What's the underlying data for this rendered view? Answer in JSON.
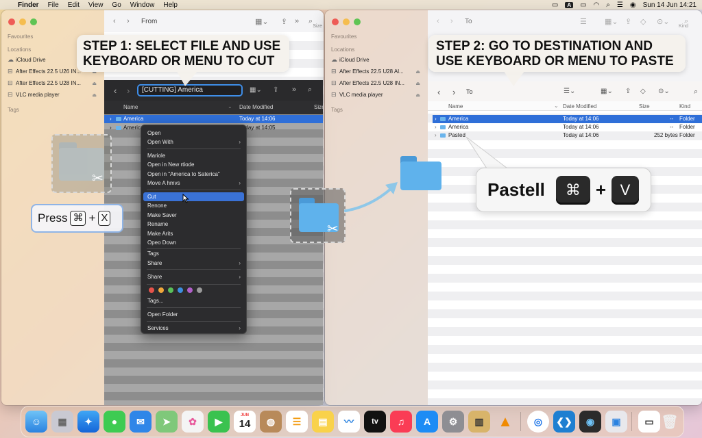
{
  "menubar": {
    "app": "Finder",
    "items": [
      "File",
      "Edit",
      "View",
      "Go",
      "Window",
      "Help"
    ],
    "input_badge": "A",
    "datetime": "Sun 14 Jun  14:21"
  },
  "left_window": {
    "title": "From",
    "size_col": "Size",
    "sidebar": {
      "favourites": "Favourites",
      "locations": "Locations",
      "items": [
        "iCloud Drive",
        "After Effects 22.5 U26 IN...",
        "After Effects 22.5 U28 IN...",
        "VLC media player"
      ],
      "tags": "Tags"
    }
  },
  "step1": {
    "line1": "STEP 1: SELECT FILE AND USE",
    "line2": "KEYBOARD OR MENU TO CUT"
  },
  "dark_finder": {
    "field": "[CUTTING] America",
    "col_name": "Name",
    "col_date": "Date Modified",
    "col_size": "Size",
    "rows": [
      {
        "name": "America",
        "date": "Today at 14:06"
      },
      {
        "name": "America",
        "date": "Today at 14:05"
      }
    ]
  },
  "context_menu": {
    "items": [
      "Open",
      "Open With",
      "Mariole",
      "Open in New rtiode",
      "Open in \"America to Saterica\"",
      "Move A hmvs",
      "Cut",
      "Renone",
      "Make Saver",
      "Rename",
      "Make Arits",
      "Opeo Down",
      "Tags",
      "Share",
      "Share",
      "Tags...",
      "Open Folder",
      "Services"
    ],
    "active": "Cut",
    "tag_colors": [
      "#e5534b",
      "#f0a73b",
      "#5ac05a",
      "#3d8fe0",
      "#b160c9",
      "#9a9a9a"
    ]
  },
  "press_hint": {
    "label": "Press",
    "key1": "⌘",
    "plus": "+",
    "key2": "X"
  },
  "right_window": {
    "title": "To",
    "size_col": "Size",
    "kind_col": "Kind",
    "sidebar": {
      "favourites": "Favourites",
      "locations": "Locations",
      "items": [
        "iCloud Drive",
        "After Effects 22.5 U28 Al...",
        "After Effects 22.5 U28 IN...",
        "VLC media player"
      ],
      "tags": "Tags"
    }
  },
  "step2": {
    "line1": "STEP 2: GO TO DESTINATION AND",
    "line2": "USE KEYBOARD OR MENU TO PASTE"
  },
  "right_finder": {
    "title": "To",
    "col_name": "Name",
    "col_date": "Date Modified",
    "col_size": "Size",
    "col_kind": "Kind",
    "rows": [
      {
        "name": "America",
        "date": "Today at 14:06",
        "size": "--",
        "kind": "Folder"
      },
      {
        "name": "America",
        "date": "Today at 14:06",
        "size": "--",
        "kind": "Folder"
      },
      {
        "name": "Pasted",
        "date": "Today at 14:06",
        "size": "252 bytes",
        "kind": "Folder"
      }
    ]
  },
  "paste_hint": {
    "label": "Pastell",
    "key1": "⌘",
    "plus": "+",
    "key2": "V"
  },
  "dock": {
    "calendar_month": "JUN",
    "calendar_day": "14",
    "tv_label": "tv"
  },
  "colors": {
    "accent_blue": "#2f6fd8",
    "folder_blue": "#5fb2ec",
    "menu_dark": "#2c2c2e"
  }
}
